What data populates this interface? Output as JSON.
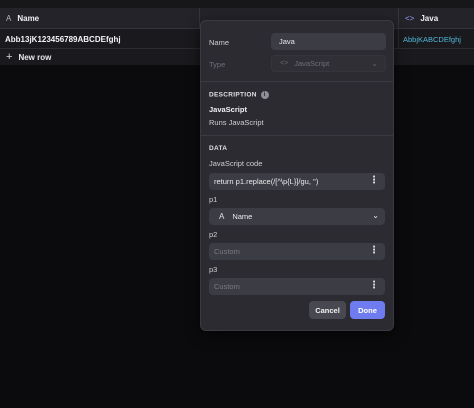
{
  "grid": {
    "columns": [
      {
        "icon": "text-type-icon",
        "icon_glyph": "A",
        "label": "Name"
      },
      {
        "icon": "code-icon",
        "icon_glyph": "<>",
        "label": "Java"
      }
    ],
    "rows": [
      {
        "name": "Abb13jK123456789ABCDEfghj",
        "java": "AbbjKABCDEfghj"
      }
    ],
    "new_row_label": "New row",
    "new_row_glyph": "+"
  },
  "panel": {
    "name_label": "Name",
    "name_value": "Java",
    "type_label": "Type",
    "type_value": "JavaScript",
    "type_icon_glyph": "<>",
    "description": {
      "section_title": "DESCRIPTION",
      "info_glyph": "i",
      "title": "JavaScript",
      "text": "Runs JavaScript"
    },
    "data": {
      "section_title": "DATA",
      "code_label": "JavaScript code",
      "code_value": "return p1.replace(/[^\\p{L}]/gu, '')",
      "p1_label": "p1",
      "p1_icon_glyph": "A",
      "p1_value": "Name",
      "p2_label": "p2",
      "p2_placeholder": "Custom",
      "p3_label": "p3",
      "p3_placeholder": "Custom"
    },
    "cancel_label": "Cancel",
    "done_label": "Done"
  },
  "colors": {
    "accent": "#6f7cf0",
    "link_cell": "#4fb6d6"
  }
}
